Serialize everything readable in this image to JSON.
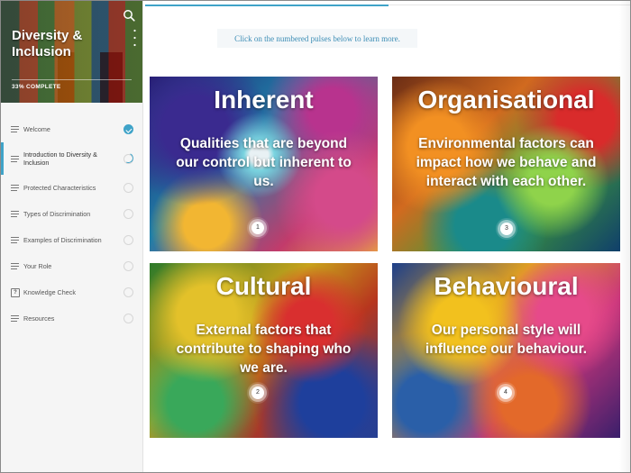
{
  "course": {
    "title": "Diversity & Inclusion",
    "progress_text": "33% COMPLETE",
    "progress": 0.33
  },
  "sidebar": {
    "items": [
      {
        "label": "Welcome",
        "status": "complete",
        "icon": "lines-icon"
      },
      {
        "label": "Introduction to Diversity & Inclusion",
        "status": "in-progress",
        "icon": "lines-icon"
      },
      {
        "label": "Protected Characteristics",
        "status": "not-started",
        "icon": "lines-icon"
      },
      {
        "label": "Types of Discrimination",
        "status": "not-started",
        "icon": "lines-icon"
      },
      {
        "label": "Examples of Discrimination",
        "status": "not-started",
        "icon": "lines-icon"
      },
      {
        "label": "Your Role",
        "status": "not-started",
        "icon": "lines-icon"
      },
      {
        "label": "Knowledge Check",
        "status": "not-started",
        "icon": "quiz-icon",
        "icon_glyph": "?"
      },
      {
        "label": "Resources",
        "status": "not-started",
        "icon": "lines-icon"
      }
    ]
  },
  "main": {
    "instruction": "Click on the numbered pulses below to learn more.",
    "cards": [
      {
        "title": "Inherent",
        "text": "Qualities that are beyond our control but inherent to us.",
        "pulse": "1"
      },
      {
        "title": "Organisational",
        "text": "Environmental factors can impact how we behave and interact with each other.",
        "pulse": "3"
      },
      {
        "title": "Cultural",
        "text": "External factors that contribute to shaping who we are.",
        "pulse": "2"
      },
      {
        "title": "Behavioural",
        "text": "Our personal style will influence our behaviour.",
        "pulse": "4"
      }
    ]
  },
  "colors": {
    "accent": "#3fa3c8",
    "sidebar_bg": "#f5f5f5"
  }
}
